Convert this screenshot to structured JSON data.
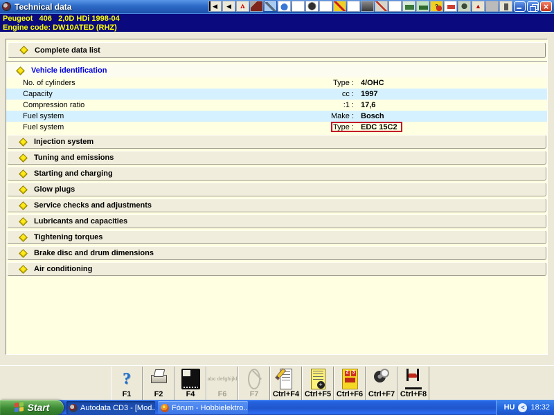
{
  "window": {
    "title": "Technical data",
    "controls": {
      "minimize": "minimize",
      "restore": "restore",
      "close": "close"
    }
  },
  "titlebar_icons": [
    {
      "name": "first-page-icon",
      "cls": "t-first",
      "glyph": "◀"
    },
    {
      "name": "back-icon",
      "cls": "t-back",
      "glyph": "◀"
    },
    {
      "name": "warning-icon",
      "cls": "t-warn",
      "glyph": "▲"
    },
    {
      "name": "crash-data-icon",
      "cls": "t-crash",
      "glyph": ""
    },
    {
      "name": "technical-data-icon-selected",
      "cls": "t-sel",
      "glyph": ""
    },
    {
      "name": "service-schedule-icon",
      "cls": "t-watch",
      "glyph": ""
    },
    {
      "name": "car-adjustments-icon",
      "cls": "t-car",
      "glyph": ""
    },
    {
      "name": "wheel-alignment-icon",
      "cls": "t-tyre",
      "glyph": ""
    },
    {
      "name": "labour-times-icon",
      "cls": "t-people",
      "glyph": ""
    },
    {
      "name": "tools-icon",
      "cls": "t-tools",
      "glyph": ""
    },
    {
      "name": "timing-belt-icon",
      "cls": "t-gate",
      "glyph": ""
    },
    {
      "name": "engine-icon",
      "cls": "t-engine",
      "glyph": ""
    },
    {
      "name": "repair-tool-icon",
      "cls": "t-tool2",
      "glyph": ""
    },
    {
      "name": "brakes-icon",
      "cls": "t-brake",
      "glyph": ""
    },
    {
      "name": "print-manager-icon",
      "cls": "t-print",
      "glyph": ""
    },
    {
      "name": "service-car-icon",
      "cls": "t-serv",
      "glyph": ""
    },
    {
      "name": "diagnostics-icon",
      "cls": "t-helm",
      "glyph": "?"
    },
    {
      "name": "bodywork-icon",
      "cls": "t-body",
      "glyph": ""
    },
    {
      "name": "disc-icon",
      "cls": "t-disc",
      "glyph": ""
    },
    {
      "name": "hazard-icon",
      "cls": "t-haz",
      "glyph": "▲"
    },
    {
      "name": "gears-icon",
      "cls": "t-gear",
      "glyph": ""
    },
    {
      "name": "switch-icon",
      "cls": "t-switch",
      "glyph": ""
    }
  ],
  "vehicle_header": {
    "line1": "Peugeot   406   2,0D HDi 1998-04",
    "line2": "Engine code: DW10ATED (RHZ)"
  },
  "content": {
    "complete_data_list": "Complete data list",
    "expanded_section": {
      "title": "Vehicle identification",
      "rows": [
        {
          "label": "No. of cylinders",
          "unit": "Type :",
          "value": "4/OHC",
          "highlighted": false
        },
        {
          "label": "Capacity",
          "unit": "cc :",
          "value": "1997",
          "highlighted": false
        },
        {
          "label": "Compression ratio",
          "unit": ":1 :",
          "value": "17,6",
          "highlighted": false
        },
        {
          "label": "Fuel system",
          "unit": "Make :",
          "value": "Bosch",
          "highlighted": false
        },
        {
          "label": "Fuel system",
          "unit": "Type :",
          "value": "EDC 15C2",
          "highlighted": true
        }
      ]
    },
    "collapsed_sections": [
      "Injection system",
      "Tuning and emissions",
      "Starting and charging",
      "Glow plugs",
      "Service checks and adjustments",
      "Lubricants and capacities",
      "Tightening torques",
      "Brake disc and drum dimensions",
      "Air conditioning"
    ]
  },
  "function_bar": {
    "buttons": [
      {
        "key": "F1",
        "icon": "help-icon",
        "disabled": false
      },
      {
        "key": "F2",
        "icon": "printer-icon",
        "disabled": false
      },
      {
        "key": "F4",
        "icon": "display-icon",
        "disabled": false
      },
      {
        "key": "F6",
        "icon": "text-block-icon",
        "disabled": true
      },
      {
        "key": "F7",
        "icon": "measure-icon",
        "disabled": true
      },
      {
        "key": "Ctrl+F4",
        "icon": "edit-note-icon",
        "disabled": false
      },
      {
        "key": "Ctrl+F5",
        "icon": "document-pointer-icon",
        "disabled": false
      },
      {
        "key": "Ctrl+F6",
        "icon": "ignition-timing-icon",
        "disabled": false
      },
      {
        "key": "Ctrl+F7",
        "icon": "wheel-check-icon",
        "disabled": false
      },
      {
        "key": "Ctrl+F8",
        "icon": "vehicle-lift-icon",
        "disabled": false
      }
    ]
  },
  "taskbar": {
    "start_label": "Start",
    "tasks": [
      {
        "title": "Autodata CD3 - [Mod...",
        "active": true
      },
      {
        "title": "Fórum - Hobbielektro...",
        "active": false
      }
    ],
    "tray": {
      "language": "HU",
      "time": "18:32"
    }
  },
  "colors": {
    "highlight_box_red": "#C41228",
    "row_yellow": "#FFFFE1",
    "row_blue": "#D5F1FF",
    "header_navy": "#0A0A7E",
    "header_text_yellow": "#FFFF00",
    "section_link_blue": "#0000E0",
    "taskbar_blue": "#2663E0",
    "start_green": "#3C8A34"
  }
}
